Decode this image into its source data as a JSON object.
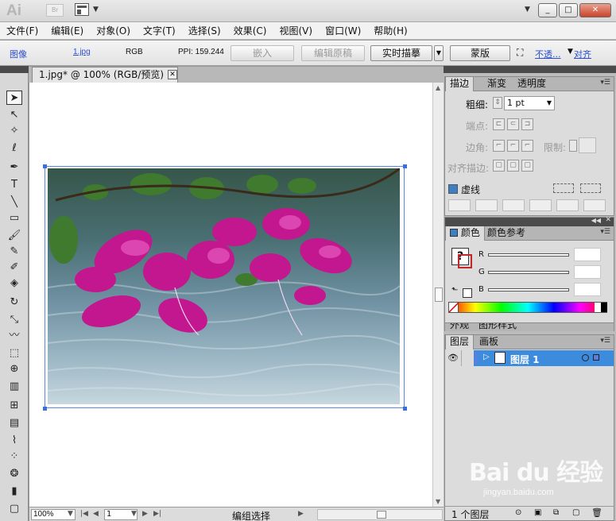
{
  "titlebar": {
    "app_logo": "Ai",
    "bridge_label": "Br",
    "window_buttons": [
      "_",
      "□",
      "✕"
    ]
  },
  "menubar": {
    "items": [
      "文件(F)",
      "编辑(E)",
      "对象(O)",
      "文字(T)",
      "选择(S)",
      "效果(C)",
      "视图(V)",
      "窗口(W)",
      "帮助(H)"
    ]
  },
  "controlbar": {
    "object_type": "图像",
    "file_name": "1.jpg",
    "color_mode": "RGB",
    "ppi": "PPI: 159.244",
    "embed_label": "嵌入",
    "edit_original_label": "编辑原稿",
    "live_trace_label": "实时描摹",
    "mask_label": "蒙版",
    "opacity_label": "不透...",
    "align_label": "对齐"
  },
  "document": {
    "tab_title": "1.jpg* @ 100% (RGB/预览)",
    "tab_close": "✕",
    "zoom": "100%",
    "page": "1",
    "status_text": "编组选择"
  },
  "toolbox": {
    "tools": [
      {
        "name": "selection-tool",
        "glyph": "➤"
      },
      {
        "name": "direct-selection-tool",
        "glyph": "↖"
      },
      {
        "name": "magic-wand-tool",
        "glyph": "✧"
      },
      {
        "name": "lasso-tool",
        "glyph": "ℓ"
      },
      {
        "name": "pen-tool",
        "glyph": "✒"
      },
      {
        "name": "type-tool",
        "glyph": "T"
      },
      {
        "name": "line-tool",
        "glyph": "╲"
      },
      {
        "name": "rectangle-tool",
        "glyph": "▭"
      },
      {
        "name": "paintbrush-tool",
        "glyph": "🖌"
      },
      {
        "name": "pencil-tool",
        "glyph": "✎"
      },
      {
        "name": "blob-brush-tool",
        "glyph": "✐"
      },
      {
        "name": "eraser-tool",
        "glyph": "◈"
      },
      {
        "name": "rotate-tool",
        "glyph": "↻"
      },
      {
        "name": "scale-tool",
        "glyph": "⤡"
      },
      {
        "name": "warp-tool",
        "glyph": "〰"
      },
      {
        "name": "free-transform-tool",
        "glyph": "⬚"
      },
      {
        "name": "shape-builder-tool",
        "glyph": "⊕"
      },
      {
        "name": "graph-tool",
        "glyph": "▥"
      },
      {
        "name": "mesh-tool",
        "glyph": "⊞"
      },
      {
        "name": "gradient-tool",
        "glyph": "▤"
      },
      {
        "name": "eyedropper-tool",
        "glyph": "⌇"
      },
      {
        "name": "blend-tool",
        "glyph": "⁘"
      },
      {
        "name": "symbol-sprayer-tool",
        "glyph": "❂"
      },
      {
        "name": "column-graph-tool",
        "glyph": "▮"
      },
      {
        "name": "artboard-tool",
        "glyph": "▢"
      }
    ]
  },
  "stroke_panel": {
    "tabs": [
      "描边",
      "渐变",
      "透明度"
    ],
    "weight_label": "粗细:",
    "weight_value": "1 pt",
    "cap_label": "端点:",
    "corner_label": "边角:",
    "limit_label": "限制:",
    "align_label": "对齐描边:",
    "dashed_label": "虚线"
  },
  "color_panel": {
    "tabs": [
      "颜色",
      "颜色参考"
    ],
    "channels": [
      "R",
      "G",
      "B"
    ]
  },
  "hidden_panel_tabs": [
    "外观",
    "图形样式"
  ],
  "layers_panel": {
    "tabs": [
      "图层",
      "画板"
    ],
    "layer_name": "图层 1",
    "layer_count": "1 个图层"
  },
  "watermark": {
    "brand": "Bai du 经验",
    "url": "jingyan.baidu.com"
  },
  "colors": {
    "selection_blue": "#3b6fe0",
    "layer_highlight": "#3c8bdc",
    "link_blue": "#2a4fd0"
  }
}
